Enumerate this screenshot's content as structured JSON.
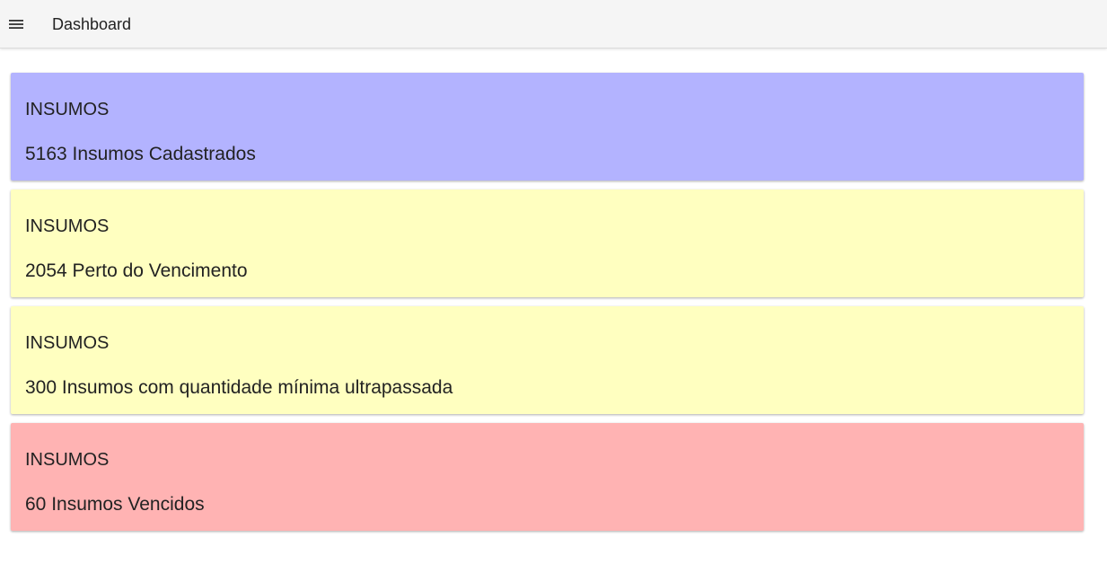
{
  "header": {
    "menu_icon": "hamburger-menu-icon",
    "title": "Dashboard"
  },
  "cards": [
    {
      "heading": "INSUMOS",
      "text": "5163 Insumos Cadastrados",
      "color": "#b3b3ff"
    },
    {
      "heading": "INSUMOS",
      "text": "2054 Perto do Vencimento",
      "color": "#ffffc0"
    },
    {
      "heading": "INSUMOS",
      "text": "300 Insumos com quantidade mínima ultrapassada",
      "color": "#ffffc0"
    },
    {
      "heading": "INSUMOS",
      "text": "60 Insumos Vencidos",
      "color": "#ffb3b3"
    }
  ]
}
